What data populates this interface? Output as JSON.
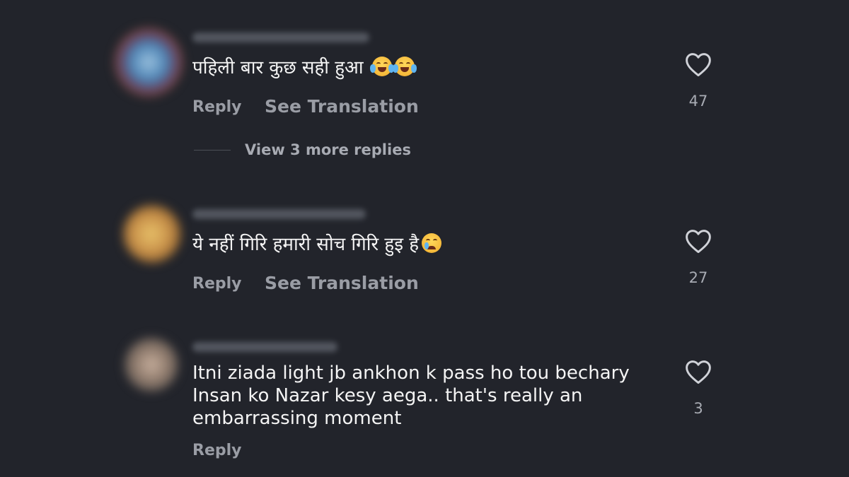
{
  "comments": [
    {
      "text": "पहिली बार कुछ सही हुआ",
      "emoji": [
        "face-with-tears-of-joy",
        "face-with-tears-of-joy"
      ],
      "reply_label": "Reply",
      "translation_label": "See Translation",
      "likes": "47",
      "more_replies_label": "View 3 more replies"
    },
    {
      "text": "ये नहीं गिरि हमारी सोच गिरि हुइ है",
      "emoji": [
        "crying-face"
      ],
      "reply_label": "Reply",
      "translation_label": "See Translation",
      "likes": "27"
    },
    {
      "text": "Itni ziada light jb ankhon k pass ho tou bechary\nInsan ko Nazar kesy aega.. that's really an\nembarrassing moment",
      "reply_label": "Reply",
      "likes": "3"
    }
  ],
  "icons": {
    "like": "heart-outline-icon"
  },
  "colors": {
    "background": "#22242b",
    "text": "#f4f4f4",
    "secondary_text": "#9a9da5"
  }
}
